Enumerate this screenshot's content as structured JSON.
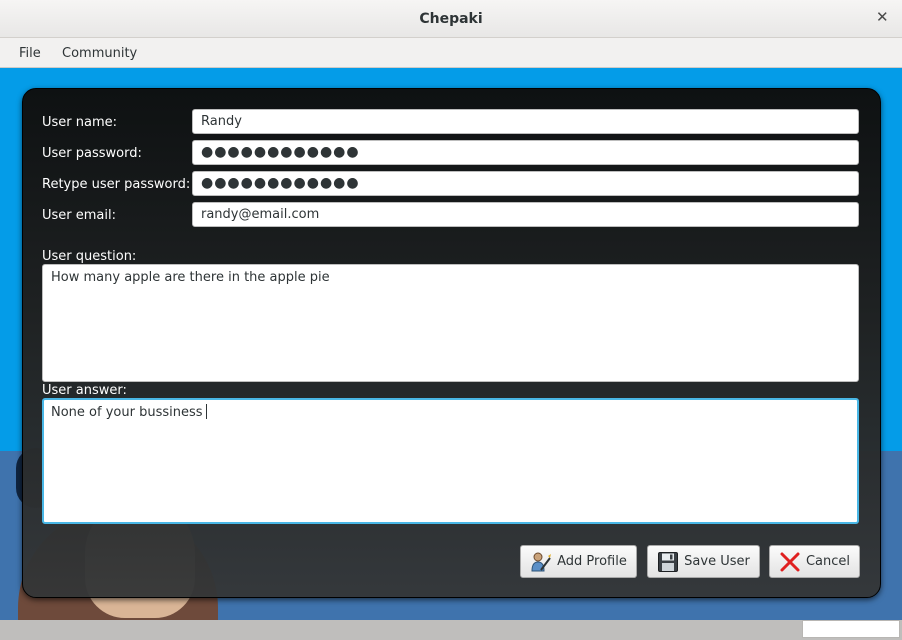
{
  "window": {
    "title": "Chepaki"
  },
  "menu": {
    "items": [
      {
        "label": "File"
      },
      {
        "label": "Community"
      }
    ]
  },
  "form": {
    "user_name": {
      "label": "User name:",
      "value": "Randy"
    },
    "user_password": {
      "label": "User password:",
      "value": "●●●●●●●●●●●●"
    },
    "retype_password": {
      "label": "Retype user password:",
      "value": "●●●●●●●●●●●●"
    },
    "user_email": {
      "label": "User email:",
      "value": "randy@email.com"
    },
    "user_question": {
      "label": "User question:",
      "value": "How many apple are there in the apple pie"
    },
    "user_answer": {
      "label": "User answer:",
      "value": "None of your bussiness"
    }
  },
  "buttons": {
    "add_profile": {
      "label": "Add Profile",
      "icon": "add-profile-icon"
    },
    "save_user": {
      "label": "Save User",
      "icon": "floppy-disk-icon"
    },
    "cancel": {
      "label": "Cancel",
      "icon": "red-x-icon",
      "color": "#e02020"
    }
  },
  "colors": {
    "sky": "#049ce8",
    "ground": "#3f73ad",
    "focus": "#49b7e6"
  }
}
